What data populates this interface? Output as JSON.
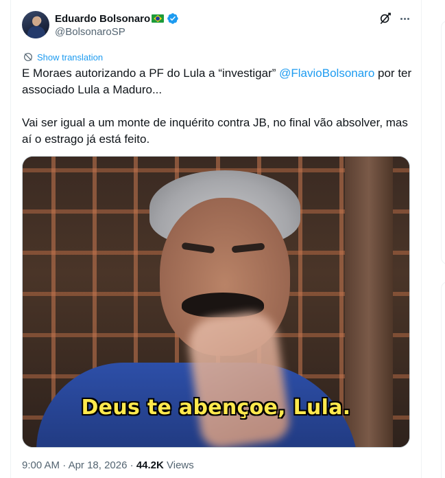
{
  "tweet": {
    "author": {
      "display_name": "Eduardo Bolsonaro",
      "flag_emoji": "brazil-flag-icon",
      "handle": "@BolsonaroSP",
      "verified": true
    },
    "show_translation": "Show translation",
    "text": {
      "line1_before": "E Moraes autorizando a PF do Lula a “investigar” ",
      "mention": "@FlavioBolsonaro",
      "line1_after": " por ter associado Lula a Maduro...",
      "paragraph2": "Vai ser igual a um monte de inquérito contra JB, no final vão absolver, mas aí o estrago já está feito."
    },
    "media": {
      "caption": "Deus te abençoe, Lula."
    },
    "meta": {
      "time": "9:00 AM",
      "sep1": " · ",
      "date": "Apr 18, 2026",
      "sep2": " · ",
      "views_count": "44.2K",
      "views_label": " Views"
    }
  },
  "colors": {
    "accent": "#1d9bf0",
    "text_primary": "#0f1419",
    "text_secondary": "#536471",
    "caption": "#ffe94d"
  }
}
